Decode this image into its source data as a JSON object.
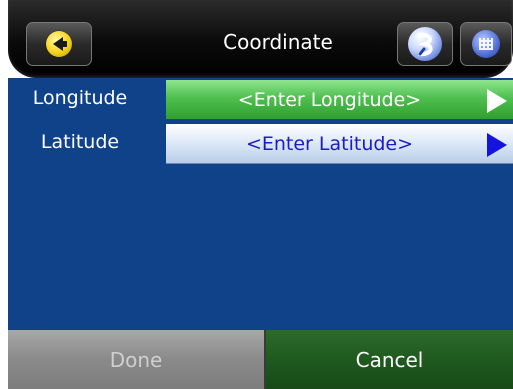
{
  "header": {
    "title": "Coordinate",
    "back_icon": "back-arrow-icon",
    "brand_icon": "brand-logo-icon",
    "menu_icon": "menu-grid-icon"
  },
  "form": {
    "longitude": {
      "label": "Longitude",
      "placeholder": "<Enter Longitude>",
      "arrow_icon": "play-arrow-icon"
    },
    "latitude": {
      "label": "Latitude",
      "placeholder": "<Enter Latitude>",
      "arrow_icon": "play-arrow-icon"
    }
  },
  "footer": {
    "done_label": "Done",
    "cancel_label": "Cancel"
  },
  "colors": {
    "background": "#0f4288",
    "longitude_field": "#4fc04f",
    "latitude_field": "#dce8f7",
    "latitude_text": "#1a1ac8",
    "cancel_button": "#1f5a1f",
    "done_button": "#8a8a8a"
  }
}
